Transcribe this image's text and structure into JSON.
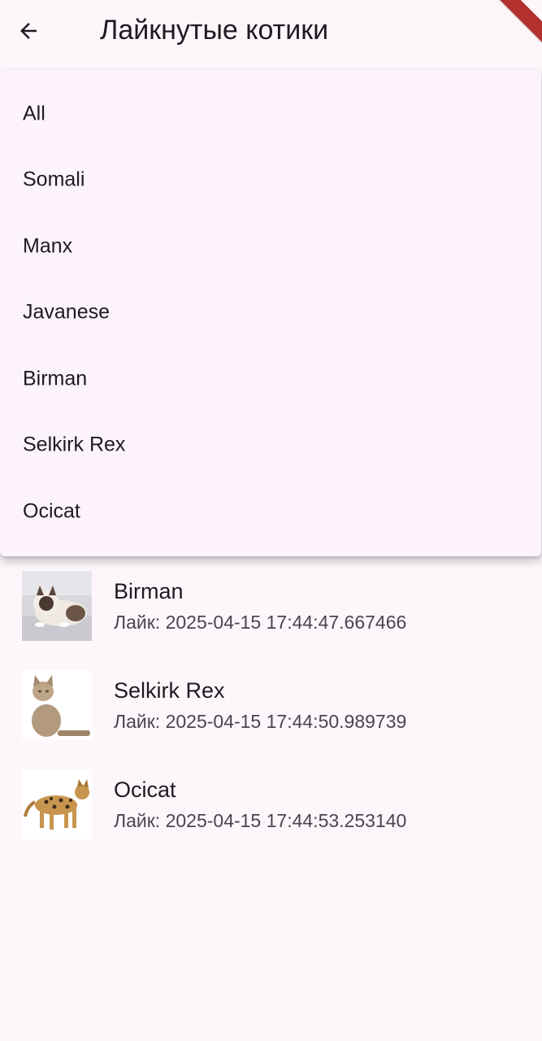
{
  "appbar": {
    "title": "Лайкнутые котики",
    "back_icon": "arrow-back-icon"
  },
  "filter_menu": {
    "items": [
      {
        "label": "All"
      },
      {
        "label": "Somali"
      },
      {
        "label": "Manx"
      },
      {
        "label": "Javanese"
      },
      {
        "label": "Birman"
      },
      {
        "label": "Selkirk Rex"
      },
      {
        "label": "Ocicat"
      }
    ]
  },
  "liked_cats": [
    {
      "breed": "Birman",
      "liked_at": "Лайк: 2025-04-15 17:44:47.667466"
    },
    {
      "breed": "Selkirk Rex",
      "liked_at": "Лайк: 2025-04-15 17:44:50.989739"
    },
    {
      "breed": "Ocicat",
      "liked_at": "Лайк: 2025-04-15 17:44:53.253140"
    }
  ],
  "colors": {
    "background": "#fdf7fc",
    "menu_background": "#fcf3fb",
    "debug_banner": "#b3302f",
    "text_primary": "#1d1b20",
    "text_secondary": "#49454f"
  }
}
